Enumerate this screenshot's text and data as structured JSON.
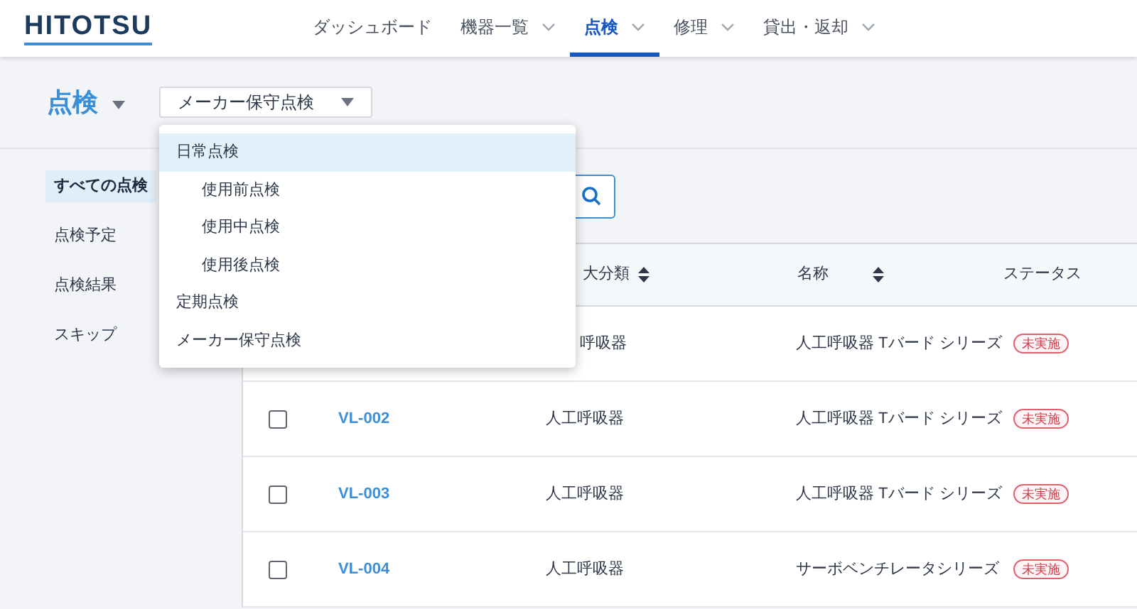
{
  "logo": "HITOTSU",
  "nav": [
    {
      "label": "ダッシュボード",
      "has_menu": false,
      "selected": false
    },
    {
      "label": "機器一覧",
      "has_menu": true,
      "selected": false
    },
    {
      "label": "点検",
      "has_menu": true,
      "selected": true
    },
    {
      "label": "修理",
      "has_menu": true,
      "selected": false
    },
    {
      "label": "貸出・返却",
      "has_menu": true,
      "selected": false
    }
  ],
  "page_title": "点検",
  "type_select": {
    "value": "メーカー保守点検"
  },
  "type_menu": [
    {
      "label": "日常点検",
      "highlighted": true,
      "children": [
        {
          "label": "使用前点検",
          "highlighted": false
        },
        {
          "label": "使用中点検",
          "highlighted": false
        },
        {
          "label": "使用後点検",
          "highlighted": false
        }
      ]
    },
    {
      "label": "定期点検",
      "highlighted": false
    },
    {
      "label": "メーカー保守点検",
      "highlighted": false
    }
  ],
  "sidebar": [
    {
      "label": "すべての点検",
      "selected": true
    },
    {
      "label": "点検予定",
      "selected": false
    },
    {
      "label": "点検結果",
      "selected": false
    },
    {
      "label": "スキップ",
      "selected": false
    }
  ],
  "table": {
    "columns": [
      {
        "label": "大分類",
        "sortable": true
      },
      {
        "label": "名称",
        "sortable": true
      },
      {
        "label": "ステータス",
        "sortable": false
      }
    ],
    "rows": [
      {
        "category": "呼吸器",
        "name": "人工呼吸器 Tバード シリーズ",
        "status": "未実施"
      },
      {
        "checked": false,
        "id": "VL-002",
        "category": "人工呼吸器",
        "name": "人工呼吸器 Tバード シリーズ",
        "status": "未実施"
      },
      {
        "checked": false,
        "id": "VL-003",
        "category": "人工呼吸器",
        "name": "人工呼吸器 Tバード シリーズ",
        "status": "未実施"
      },
      {
        "checked": false,
        "id": "VL-004",
        "category": "人工呼吸器",
        "name": "サーボベンチレータシリーズ",
        "status": "未実施"
      }
    ]
  }
}
